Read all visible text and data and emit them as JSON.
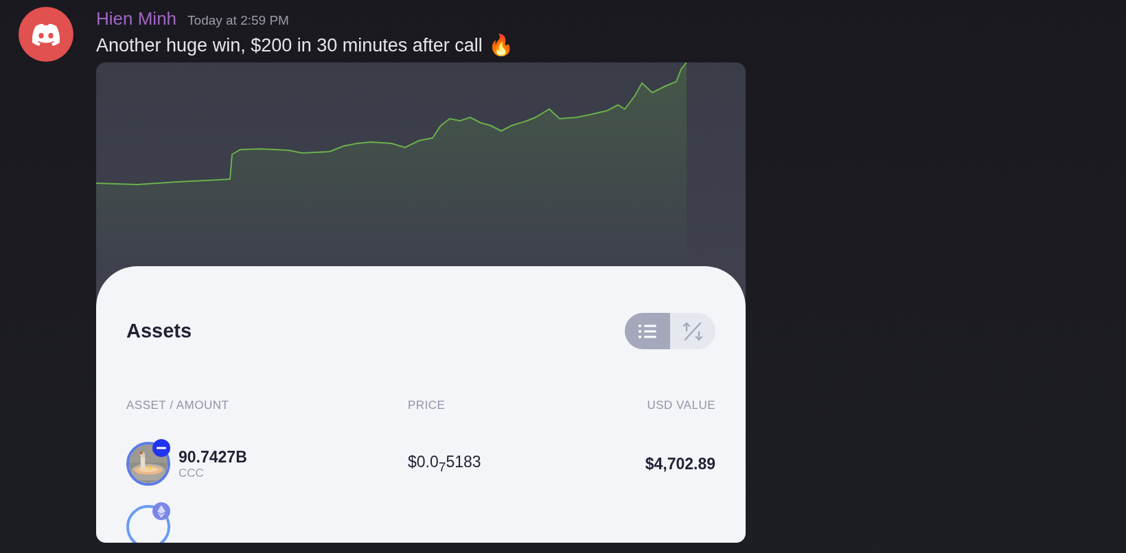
{
  "message": {
    "author": "Hien Minh",
    "timestamp": "Today at 2:59 PM",
    "text": "Another huge win, $200 in 30 minutes after call",
    "emoji": "🔥"
  },
  "assets": {
    "title": "Assets",
    "view_toggle": [
      {
        "kind": "list",
        "selected": true
      },
      {
        "kind": "percent",
        "selected": false
      }
    ],
    "columns": [
      "ASSET / AMOUNT",
      "PRICE",
      "USD VALUE"
    ],
    "rows": [
      {
        "amount": "90.7427B",
        "symbol": "CCC",
        "price": "$0.0$_{7}$5183",
        "usd_value": "$4,702.89"
      }
    ]
  }
}
